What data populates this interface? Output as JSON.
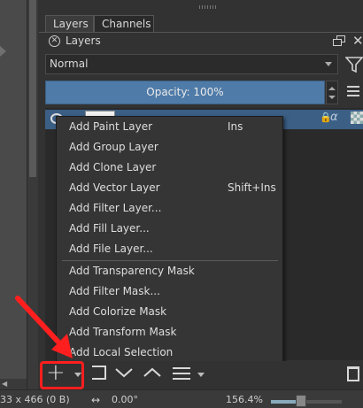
{
  "docker": {
    "tabs": [
      "Layers",
      "Channels"
    ],
    "panel_title": "Layers",
    "blending_mode": "Normal",
    "opacity_label": "Opacity:  100%"
  },
  "context_menu": {
    "items": [
      {
        "label": "Add Paint Layer",
        "shortcut": "Ins"
      },
      {
        "label": "Add Group Layer",
        "shortcut": ""
      },
      {
        "label": "Add Clone Layer",
        "shortcut": ""
      },
      {
        "label": "Add Vector Layer",
        "shortcut": "Shift+Ins"
      },
      {
        "label": "Add Filter Layer...",
        "shortcut": ""
      },
      {
        "label": "Add Fill Layer...",
        "shortcut": ""
      },
      {
        "label": "Add File Layer...",
        "shortcut": ""
      },
      {
        "label": "Add Transparency Mask",
        "shortcut": ""
      },
      {
        "label": "Add Filter Mask...",
        "shortcut": ""
      },
      {
        "label": "Add Colorize Mask",
        "shortcut": ""
      },
      {
        "label": "Add Transform Mask",
        "shortcut": ""
      },
      {
        "label": "Add Local Selection",
        "shortcut": ""
      }
    ]
  },
  "status": {
    "size": "33 x 466 (0 B)",
    "rotation": "0.00°",
    "zoom": "156.4%"
  },
  "colors": {
    "opacity_bar": "#4f7ba8",
    "selected_row": "#3c5f86",
    "highlight_annotation": "#ff1f1f"
  }
}
